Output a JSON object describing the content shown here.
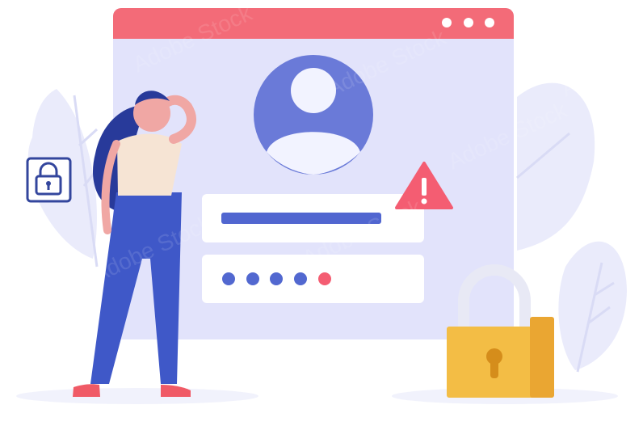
{
  "illustration": {
    "title": "",
    "watermark_text": "Adobe Stock",
    "colors": {
      "window_header": "#f36b78",
      "window_body": "#e2e3fb",
      "window_dots": "#ffffff",
      "avatar_bg": "#6a7ad8",
      "avatar_fg": "#f2f3ff",
      "field_bg": "#ffffff",
      "field_line": "#5166d0",
      "password_dot": "#5268d0",
      "password_dot_error": "#f45d72",
      "warning": "#f45d72",
      "padlock_body": "#f3bd45",
      "padlock_shackle": "#e8e9f5",
      "woman_pants": "#3f58c8",
      "woman_shirt": "#f6e4d4",
      "woman_hair": "#283a9a",
      "woman_skin": "#f0a7a4",
      "shoes": "#f05a66",
      "leaves": "#eaebfb"
    },
    "icons": [
      "lock-icon",
      "warning-icon",
      "user-avatar-icon",
      "padlock-icon"
    ]
  }
}
